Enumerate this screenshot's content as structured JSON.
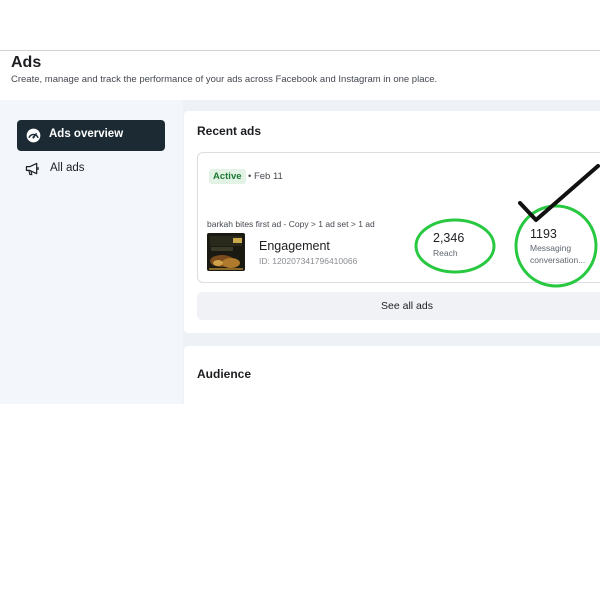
{
  "header": {
    "title": "Ads",
    "subtitle": "Create, manage and track the performance of your ads across Facebook and Instagram in one place."
  },
  "sidebar": {
    "items": [
      {
        "label": "Ads overview",
        "icon": "speedometer-icon",
        "active": true
      },
      {
        "label": "All ads",
        "icon": "megaphone-icon",
        "active": false
      }
    ]
  },
  "recent_ads": {
    "title": "Recent ads",
    "status": "Active",
    "date": "• Feb 11",
    "ad_path": "barkah bites first ad - Copy > 1 ad set > 1 ad",
    "ad_name": "Engagement",
    "ad_id": "ID: 120207341796410066",
    "metrics": [
      {
        "value": "2,346",
        "label": "Reach"
      },
      {
        "value": "1193",
        "label": "Messaging conversation..."
      }
    ],
    "see_all": "See all ads"
  },
  "audience": {
    "title": "Audience"
  },
  "colors": {
    "active_nav_bg": "#1c2b33",
    "active_badge_text": "#1e7a34",
    "annotation_green": "#28c840",
    "annotation_check": "#111111"
  }
}
